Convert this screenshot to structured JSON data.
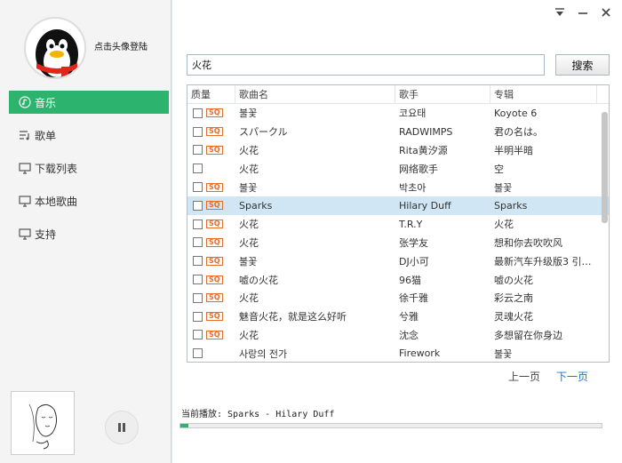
{
  "sidebar": {
    "login_label": "点击头像登陆",
    "nav": [
      {
        "label": "音乐",
        "icon": "music-icon",
        "active": true
      },
      {
        "label": "歌单",
        "icon": "playlist-icon",
        "active": false
      },
      {
        "label": "下载列表",
        "icon": "monitor-icon",
        "active": false
      },
      {
        "label": "本地歌曲",
        "icon": "monitor-icon",
        "active": false
      },
      {
        "label": "支持",
        "icon": "monitor-icon",
        "active": false
      }
    ]
  },
  "search": {
    "value": "火花",
    "button": "搜索"
  },
  "table": {
    "headers": [
      "质量",
      "歌曲名",
      "歌手",
      "专辑"
    ],
    "rows": [
      {
        "sq": true,
        "title": "불꽃",
        "artist": "코요태",
        "album": "Koyote 6"
      },
      {
        "sq": true,
        "title": "スパークル",
        "artist": "RADWIMPS",
        "album": "君の名は。"
      },
      {
        "sq": true,
        "title": "火花",
        "artist": "Rita黄汐源",
        "album": "半明半暗"
      },
      {
        "sq": false,
        "title": "火花",
        "artist": "网络歌手",
        "album": "空"
      },
      {
        "sq": true,
        "title": "불꽃",
        "artist": "박초아",
        "album": "불꽃"
      },
      {
        "sq": true,
        "title": "Sparks",
        "artist": "Hilary Duff",
        "album": "Sparks",
        "selected": true
      },
      {
        "sq": true,
        "title": "火花",
        "artist": "T.R.Y",
        "album": "火花"
      },
      {
        "sq": true,
        "title": "火花",
        "artist": "张学友",
        "album": "想和你去吹吹风"
      },
      {
        "sq": true,
        "title": "불꽃",
        "artist": "DJ小可",
        "album": "最新汽车升级版3 引…"
      },
      {
        "sq": true,
        "title": "嘘の火花",
        "artist": "96猫",
        "album": "嘘の火花"
      },
      {
        "sq": true,
        "title": "火花",
        "artist": "徐千雅",
        "album": "彩云之南"
      },
      {
        "sq": true,
        "title": "魅音火花，就是这么好听",
        "artist": "兮雅",
        "album": "灵魂火花"
      },
      {
        "sq": true,
        "title": "火花",
        "artist": "沈念",
        "album": "多想留在你身边"
      },
      {
        "sq": false,
        "title": "사랑의 전가",
        "artist": "Firework",
        "album": "불꽃"
      }
    ]
  },
  "pager": {
    "prev": "上一页",
    "next": "下一页"
  },
  "player": {
    "now_playing": "当前播放: Sparks - Hilary Duff",
    "progress": 0.02
  },
  "colors": {
    "accent": "#2cb36e",
    "sq": "#e56b2a",
    "link": "#1a73d9"
  }
}
